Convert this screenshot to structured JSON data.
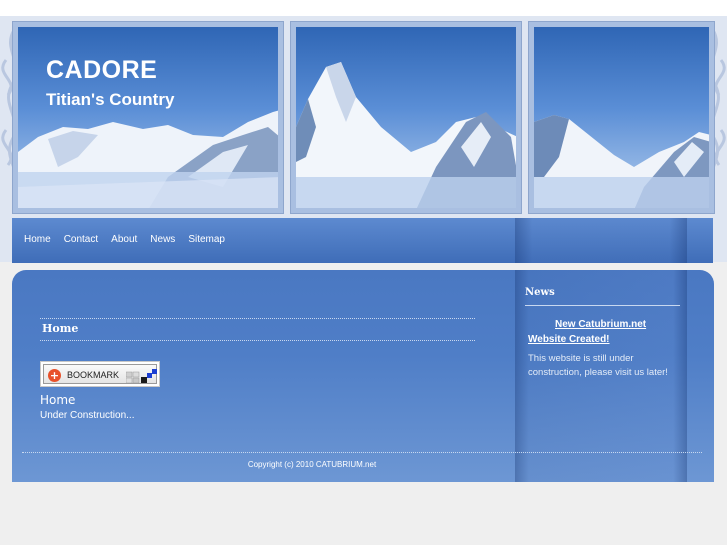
{
  "header": {
    "title": "CADORE",
    "subtitle": "Titian's Country"
  },
  "nav": {
    "items": [
      {
        "label": "Home"
      },
      {
        "label": "Contact"
      },
      {
        "label": "About"
      },
      {
        "label": "News"
      },
      {
        "label": "Sitemap"
      }
    ]
  },
  "main": {
    "heading": "Home",
    "bookmark_label": "BOOKMARK",
    "page_title": "Home",
    "body": "Under Construction..."
  },
  "sidebar": {
    "heading": "News",
    "news_link": "New Catubrium.net Website Created!",
    "news_body": "This website is still under construction, please visit us later!"
  },
  "footer": {
    "copyright": "Copyright (c) 2010 CATUBRIUM.net"
  },
  "colors": {
    "panel_blue": "#4f7ec7",
    "nav_blue": "#4f7dc4",
    "frame_blue": "#a9bfe1"
  },
  "icons": [
    "swirl-ornament",
    "plus-icon",
    "bookmark-share-icons"
  ]
}
